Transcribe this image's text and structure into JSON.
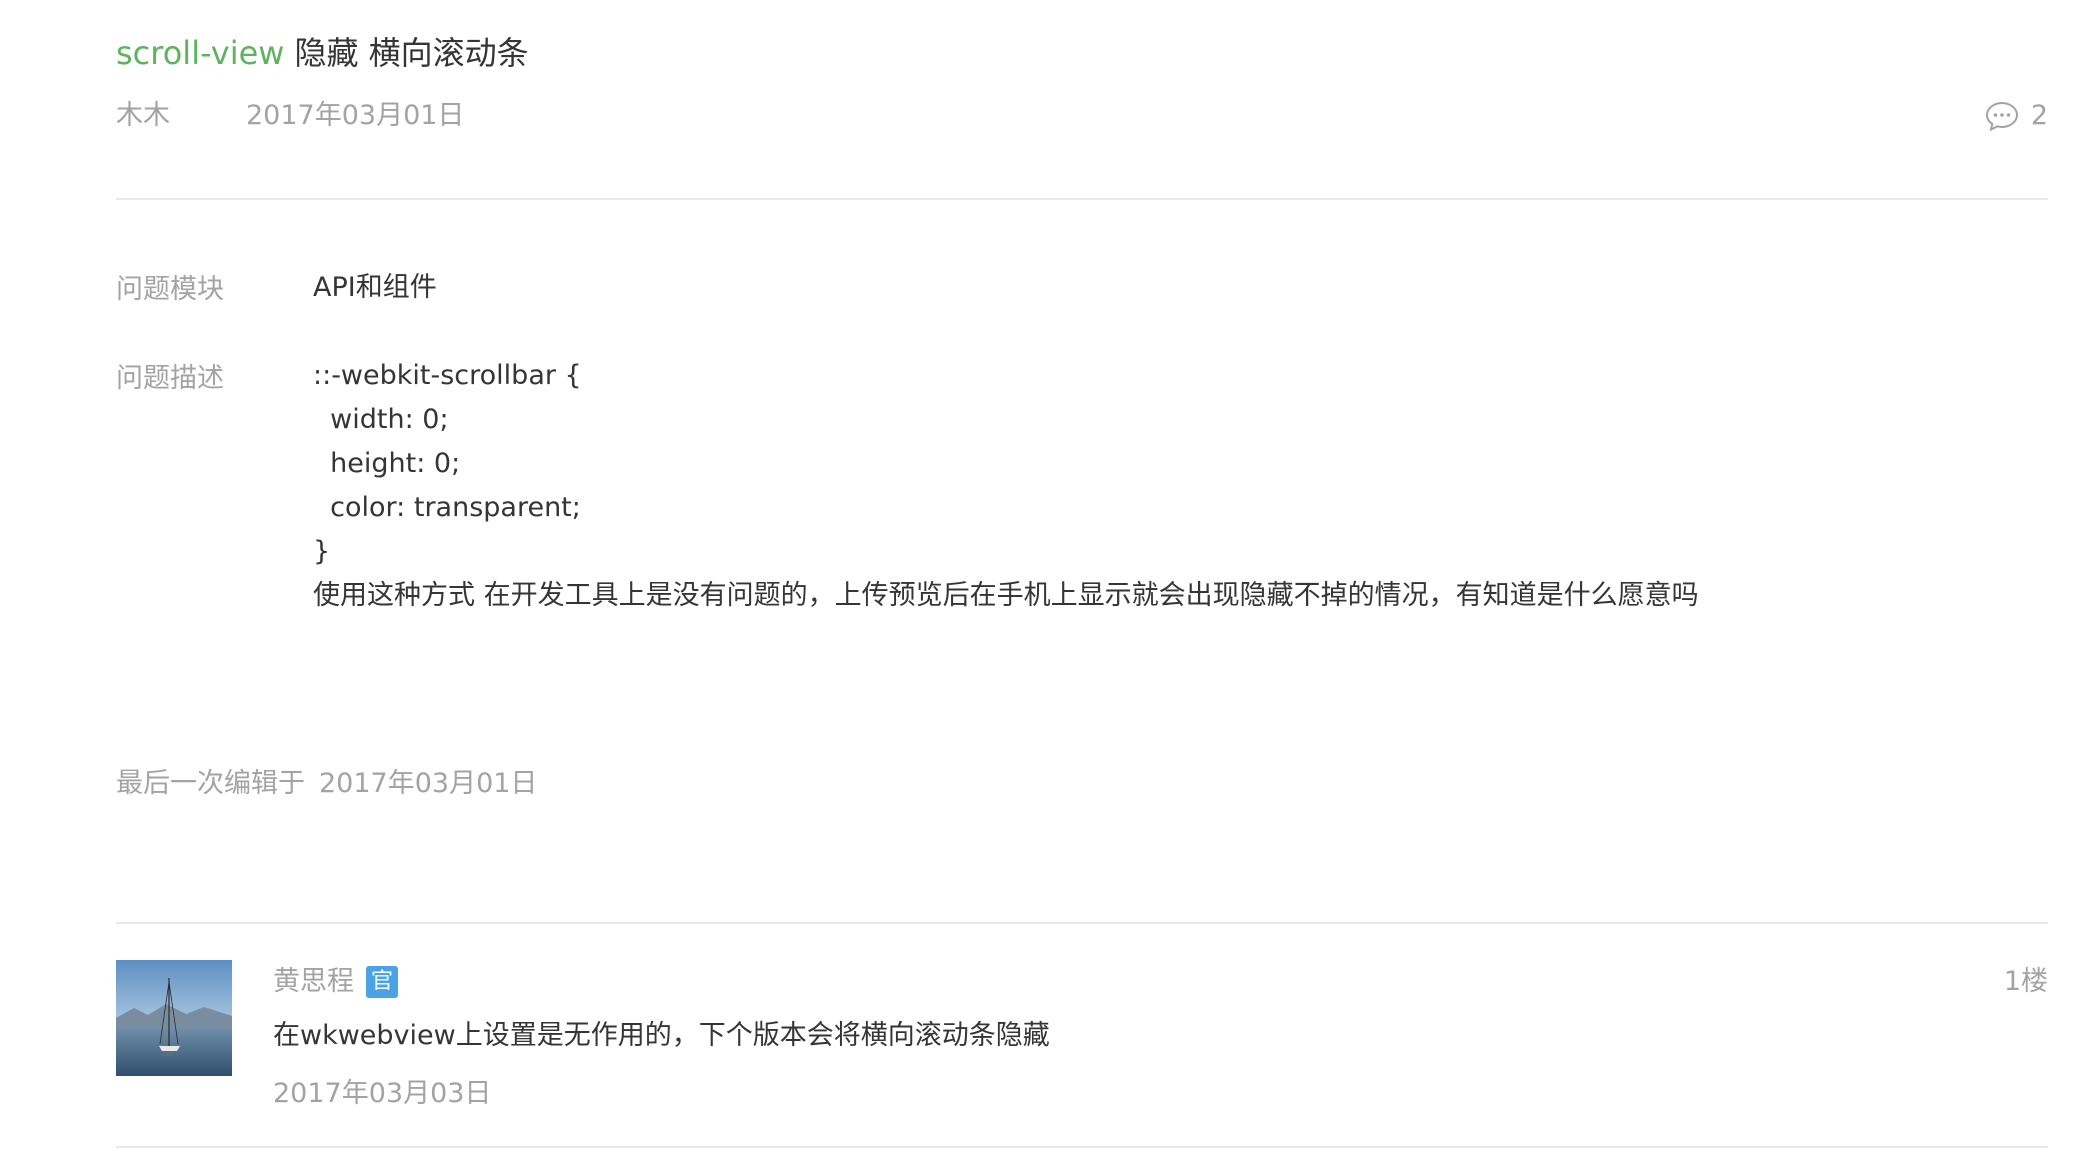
{
  "question": {
    "title_tag": "scroll-view",
    "title_text": "隐藏 横向滚动条",
    "author": "木木",
    "date": "2017年03月01日",
    "comment_icon": "comment-bubble-icon",
    "comment_count": "2",
    "module_label": "问题模块",
    "module_value": "API和组件",
    "description_label": "问题描述",
    "description_lines": [
      "::-webkit-scrollbar {",
      "  width: 0;",
      "  height: 0;",
      "  color: transparent;",
      "}",
      "使用这种方式 在开发工具上是没有问题的，上传预览后在手机上显示就会出现隐藏不掉的情况，有知道是什么愿意吗"
    ],
    "edited_label": "最后一次编辑于",
    "edited_date": "2017年03月01日"
  },
  "reply": {
    "avatar_icon": "sailboat-avatar-image",
    "author": "黄思程",
    "badge": "官",
    "badge_color": "#4aa3e6",
    "floor": "1楼",
    "content": "在wkwebview上设置是无作用的，下个版本会将横向滚动条隐藏",
    "date": "2017年03月03日"
  },
  "colors": {
    "tag": "#5fb35e",
    "text": "#353535",
    "muted": "#a3a3a3",
    "divider": "#e8e8e8"
  }
}
